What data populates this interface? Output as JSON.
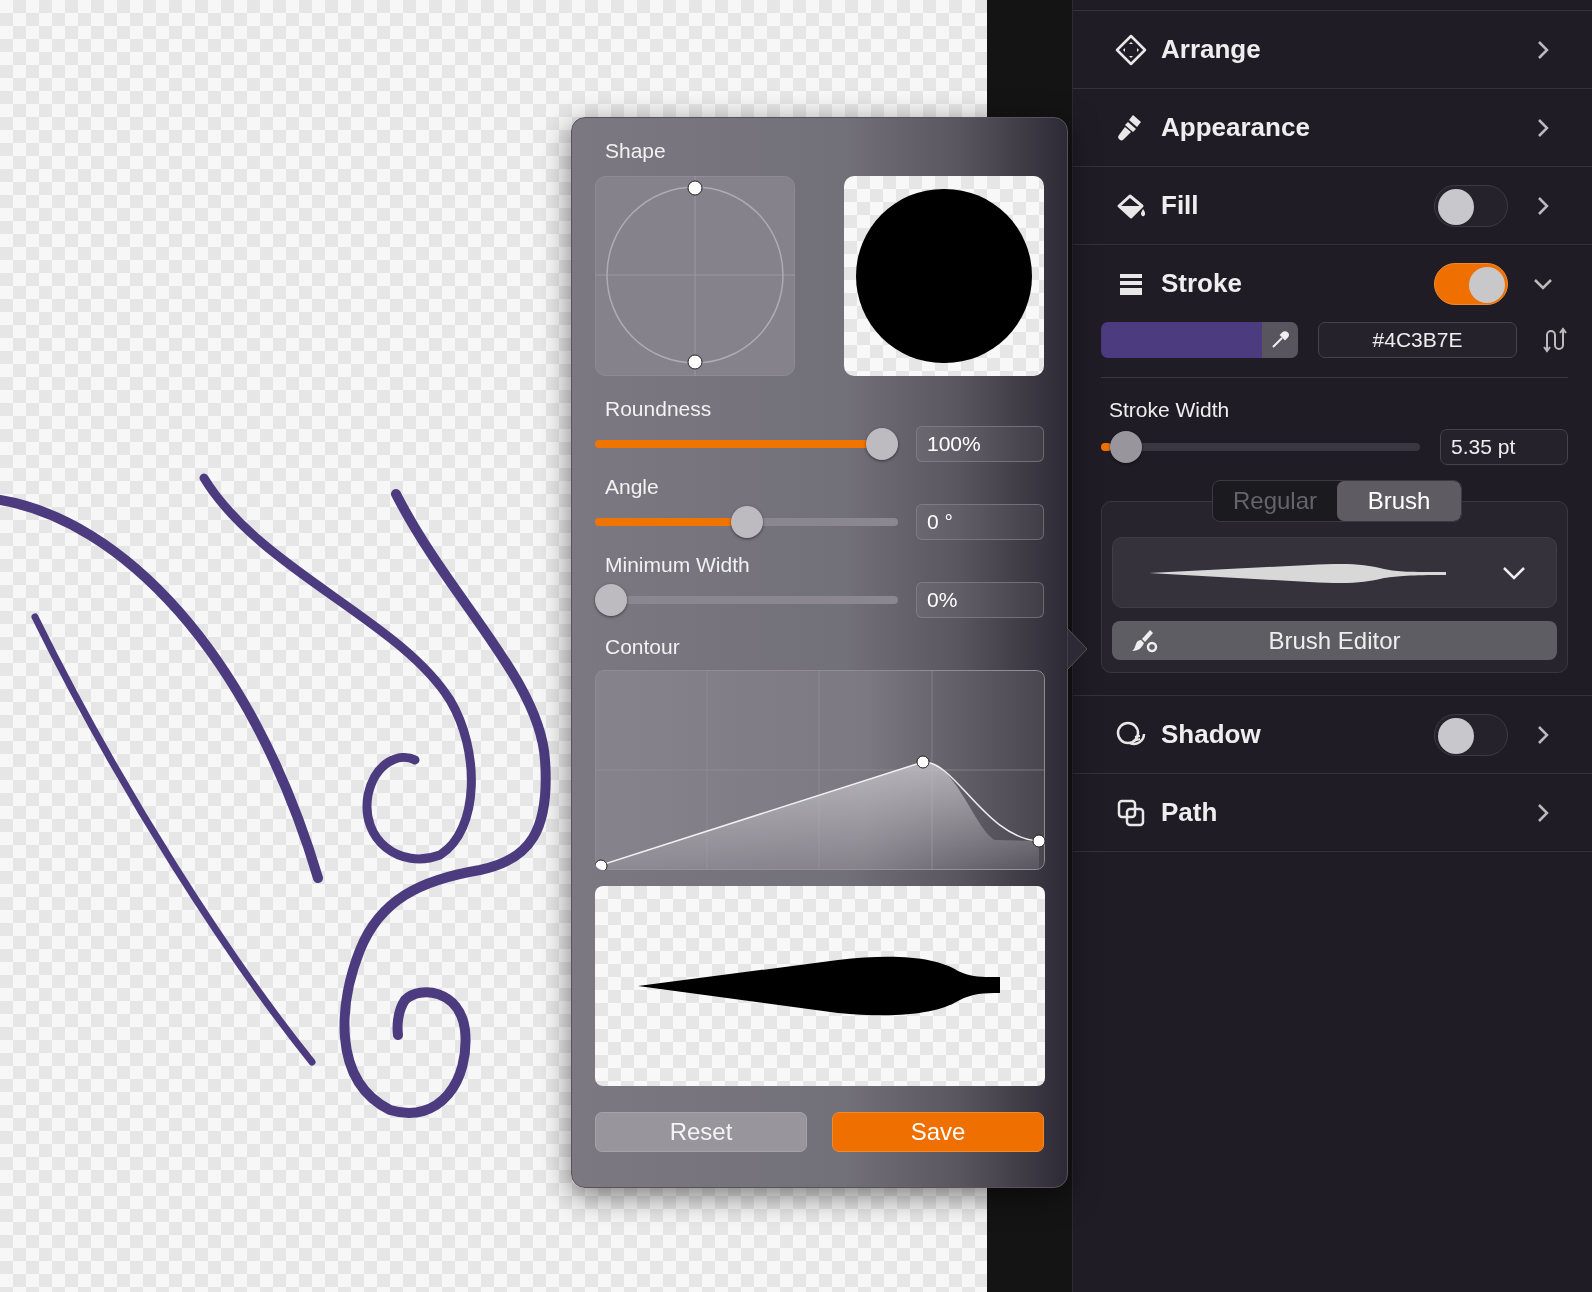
{
  "brush_popover": {
    "shape_label": "Shape",
    "sliders": [
      {
        "label": "Roundness",
        "level": 1,
        "value": "100%"
      },
      {
        "label": "Angle",
        "level": 0.5,
        "value": "0 °"
      },
      {
        "label": "Minimum Width",
        "level": 0,
        "value": "0%"
      }
    ],
    "contour_label": "Contour",
    "buttons": [
      {
        "label": "Reset",
        "kind": "secondary"
      },
      {
        "label": "Save",
        "kind": "primary"
      }
    ]
  },
  "inspector": {
    "sections": [
      {
        "label": "Arrange",
        "kind": "plain",
        "expanded": false
      },
      {
        "label": "Appearance",
        "kind": "plain",
        "expanded": false
      },
      {
        "label": "Fill",
        "kind": "toggle",
        "on": false,
        "expanded": false
      },
      {
        "label": "Stroke",
        "kind": "toggle",
        "on": true,
        "expanded": true,
        "details": {
          "color_hex": "#4C3B7E",
          "stroke_width": {
            "label": "Stroke Width",
            "level": 0.03,
            "value": "5.35 pt"
          },
          "mode_tabs": [
            {
              "label": "Regular",
              "selected": false
            },
            {
              "label": "Brush",
              "selected": true
            }
          ],
          "brush_editor_button": "Brush Editor"
        }
      },
      {
        "label": "Shadow",
        "kind": "toggle",
        "on": false,
        "expanded": false
      },
      {
        "label": "Path",
        "kind": "plain",
        "expanded": false
      }
    ]
  }
}
